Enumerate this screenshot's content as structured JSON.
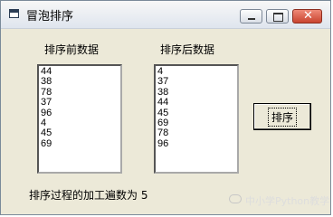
{
  "window": {
    "title": "冒泡排序"
  },
  "labels": {
    "before": "排序前数据",
    "after": "排序后数据"
  },
  "list_before": [
    "44",
    "38",
    "78",
    "37",
    "96",
    "4",
    "45",
    "69"
  ],
  "list_after": [
    "4",
    "37",
    "38",
    "44",
    "45",
    "69",
    "78",
    "96"
  ],
  "sort_button": "排序",
  "status": "排序过程的加工遍数为 5",
  "watermark": "中小学Python教学"
}
